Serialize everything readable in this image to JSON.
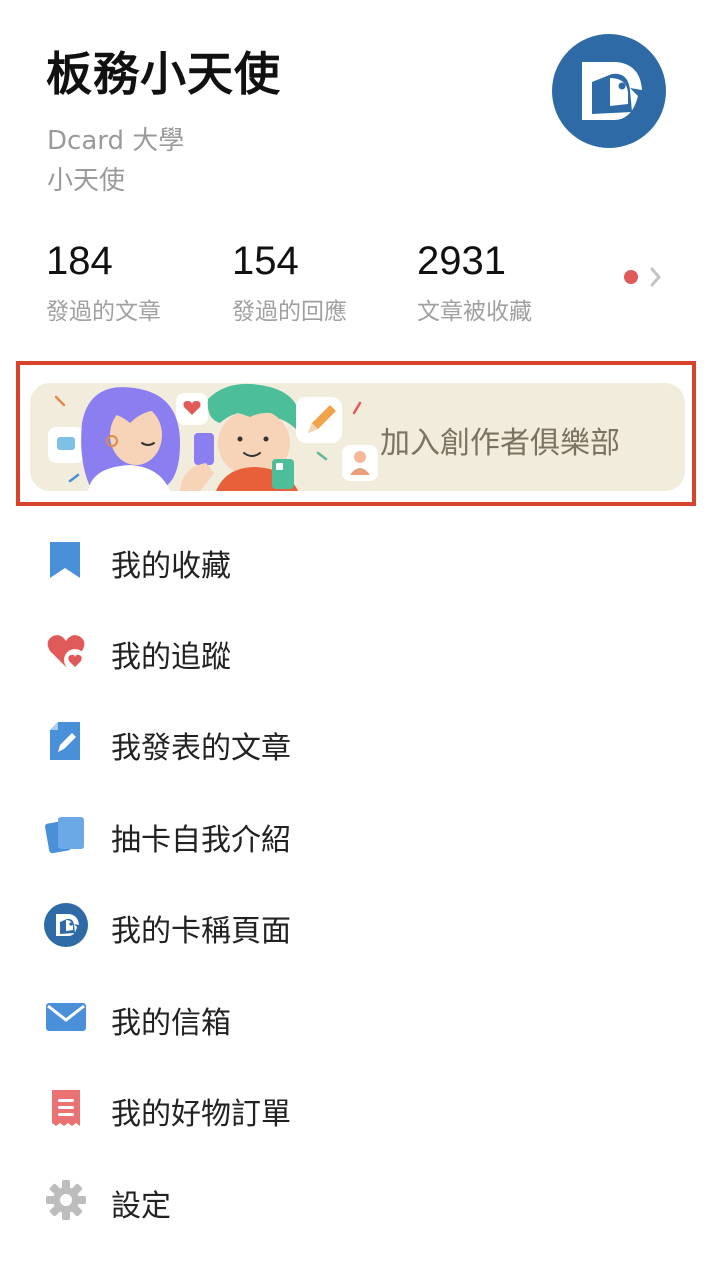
{
  "profile": {
    "name": "板務小天使",
    "school": "Dcard 大學",
    "department": "小天使"
  },
  "stats": [
    {
      "value": "184",
      "label": "發過的文章"
    },
    {
      "value": "154",
      "label": "發過的回應"
    },
    {
      "value": "2931",
      "label": "文章被收藏"
    }
  ],
  "banner": {
    "label": "加入創作者俱樂部"
  },
  "menu": [
    {
      "label": "我的收藏",
      "icon": "bookmark-icon"
    },
    {
      "label": "我的追蹤",
      "icon": "heart-icon"
    },
    {
      "label": "我發表的文章",
      "icon": "edit-document-icon"
    },
    {
      "label": "抽卡自我介紹",
      "icon": "cards-icon"
    },
    {
      "label": "我的卡稱頁面",
      "icon": "dcard-profile-icon"
    },
    {
      "label": "我的信箱",
      "icon": "mail-icon"
    },
    {
      "label": "我的好物訂單",
      "icon": "receipt-icon"
    },
    {
      "label": "設定",
      "icon": "gear-icon"
    }
  ],
  "colors": {
    "brand_blue": "#2e6ba6",
    "icon_blue": "#4a90d9",
    "icon_red": "#e05a5a",
    "highlight_border": "#d9432c",
    "banner_bg": "#f1ecdb"
  }
}
